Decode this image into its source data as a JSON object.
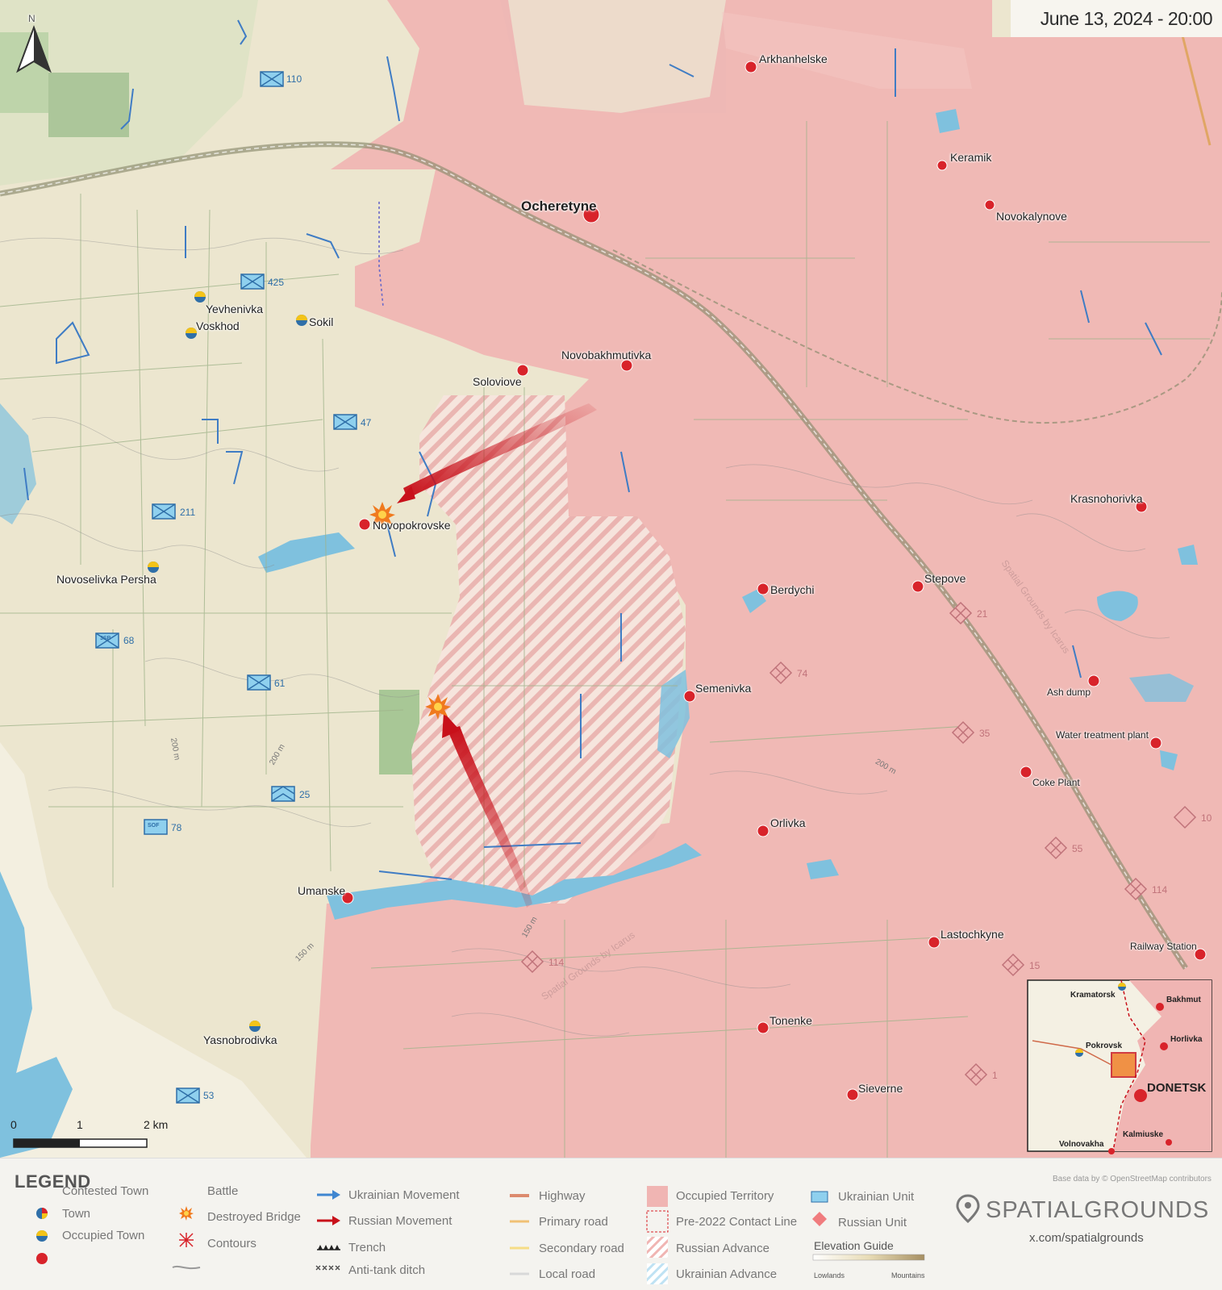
{
  "date": "June 13, 2024 - 20:00",
  "north_icon": "north-arrow-icon",
  "north_label": "N",
  "colors": {
    "occupied_fill": "#f0b5b3",
    "occupied_town": "#d8232a",
    "ukraine_blue": "#2f6fa8",
    "ukraine_yellow": "#f3c318",
    "russian_arrow": "#c8101a",
    "water": "#7fc1de"
  },
  "towns": {
    "arkhanhelske": "Arkhanhelske",
    "keramik": "Keramik",
    "ocheretyne": "Ocheretyne",
    "novokalynove": "Novokalynove",
    "yevhenivka": "Yevhenivka",
    "voskhod": "Voskhod",
    "sokil": "Sokil",
    "novobakhmutivka": "Novobakhmutivka",
    "soloviove": "Soloviove",
    "novopokrovske": "Novopokrovske",
    "novoselivka_persha": "Novoselivka Persha",
    "krasnohorivka": "Krasnohorivka",
    "berdychi": "Berdychi",
    "stepove": "Stepove",
    "ash_dump": "Ash dump",
    "semenivka": "Semenivka",
    "water_treatment_plant": "Water treatment plant",
    "coke_plant": "Coke Plant",
    "orlivka": "Orlivka",
    "umanske": "Umanske",
    "lastochkyne": "Lastochkyne",
    "railway_station": "Railway Station",
    "tonenke": "Tonenke",
    "yasnobrodivka": "Yasnobrodivka",
    "sieverne": "Sieverne"
  },
  "ua_units": {
    "u110": "110",
    "u425": "425",
    "u47": "47",
    "u211": "211",
    "u68": "68",
    "u61": "61",
    "u25": "25",
    "u78": "78",
    "u53": "53"
  },
  "ua_unit_tags": {
    "u68": "3SB",
    "u78": "SOF"
  },
  "ru_units": {
    "r21": "21",
    "r74": "74",
    "r35": "35",
    "r10": "10",
    "r55": "55",
    "r114a": "114",
    "r114b": "114",
    "r15": "15",
    "r1": "1"
  },
  "contours": {
    "c1": "200 m",
    "c2": "200 m",
    "c3": "200 m",
    "c4": "150 m",
    "c5": "150 m"
  },
  "watermark": "Spatial Grounds by Icarus",
  "scale": {
    "zero": "0",
    "one": "1",
    "two": "2 km"
  },
  "inset": {
    "kramatorsk": "Kramatorsk",
    "bakhmut": "Bakhmut",
    "pokrovsk": "Pokrovsk",
    "horlivka": "Horlivka",
    "donetsk": "DONETSK",
    "volnovakha": "Volnovakha",
    "kalmiuske": "Kalmiuske"
  },
  "legend": {
    "title": "LEGEND",
    "contested_town": "Contested Town",
    "town": "Town",
    "occupied_town": "Occupied Town",
    "battle": "Battle",
    "destroyed_bridge": "Destroyed Bridge",
    "contours": "Contours",
    "ukrainian_movement": "Ukrainian Movement",
    "russian_movement": "Russian Movement",
    "trench": "Trench",
    "anti_tank_ditch": "Anti-tank ditch",
    "highway": "Highway",
    "primary_road": "Primary road",
    "secondary_road": "Secondary road",
    "local_road": "Local road",
    "occupied_territory": "Occupied Territory",
    "pre2022_line": "Pre-2022 Contact Line",
    "russian_advance": "Russian Advance",
    "ukrainian_advance": "Ukrainian Advance",
    "ukrainian_unit": "Ukrainian Unit",
    "russian_unit": "Russian Unit",
    "elevation_guide": "Elevation Guide",
    "lowlands": "Lowlands",
    "mountains": "Mountains",
    "brand": "SPATIALGROUNDS",
    "brand_url": "x.com/spatialgrounds",
    "base_data": "Base data by © OpenStreetMap contributors"
  }
}
